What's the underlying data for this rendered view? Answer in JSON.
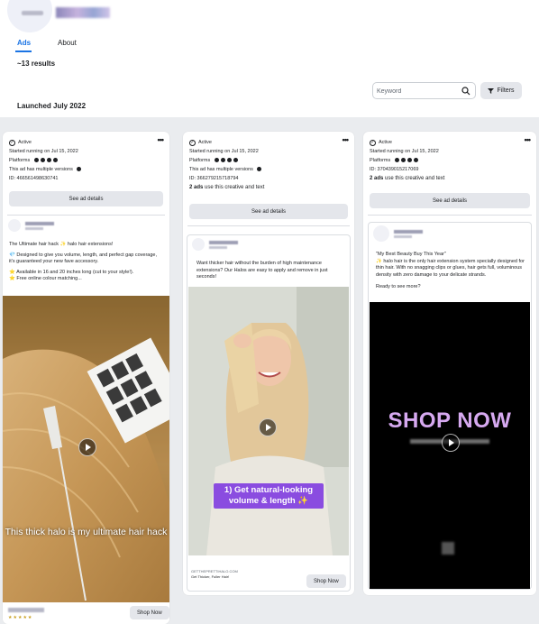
{
  "header": {
    "tabs": [
      {
        "label": "Ads",
        "active": true
      },
      {
        "label": "About",
        "active": false
      }
    ],
    "results": "~13 results",
    "search": {
      "placeholder": "Keyword",
      "value": ""
    },
    "filters_label": "Filters",
    "section_title": "Launched July 2022"
  },
  "cards": [
    {
      "status": "Active",
      "started": "Started running on Jul 15, 2022",
      "platforms_label": "Platforms",
      "versions_note": "This ad has multiple versions",
      "id": "ID: 466561498630741",
      "see_details": "See ad details",
      "creative": {
        "body_lines": [
          "The Ultimate hair hack ✨ halo hair extensions!",
          "💎 Designed to give you volume, length, and perfect gap coverage, it’s guaranteed your new fave accessory.",
          "⭐ Available in 16 and 20 inches long (cut to your style!).",
          "⭐ Free online colour matching..."
        ],
        "video_caption": "This thick halo is my ultimate hair hack",
        "cta": "Shop Now"
      }
    },
    {
      "status": "Active",
      "started": "Started running on Jul 15, 2022",
      "platforms_label": "Platforms",
      "versions_note": "This ad has multiple versions",
      "id": "ID: 366279215718794",
      "ads_count": "2 ads",
      "ads_count_rest": "use this creative and text",
      "see_details": "See ad details",
      "creative": {
        "body_lines": [
          "Want thicker hair without the burden of high maintenance extensions? Our Halos are easy to apply and remove in just seconds!"
        ],
        "video_caption": "1) Get natural-looking volume & length ✨",
        "link_domain": "GETTHEPRETTIHALO.COM",
        "link_title": "Get Thicker, Fuller Hair!",
        "cta": "Shop Now"
      }
    },
    {
      "status": "Active",
      "started": "Started running on Jul 15, 2022",
      "platforms_label": "Platforms",
      "id": "ID: 370439015217069",
      "ads_count": "2 ads",
      "ads_count_rest": "use this creative and text",
      "see_details": "See ad details",
      "creative": {
        "body_lines": [
          "\"My Best Beauty Buy This Year\"",
          "✨ halo hair is the only hair extension system specially designed for thin hair. With no snagging clips or glues, hair gets full, voluminous density with zero damage to your delicate strands.",
          "Ready to see more?"
        ],
        "video_text": "SHOP NOW"
      }
    }
  ],
  "colors": {
    "accent": "#1b74e4",
    "feed_bg": "#eaecef",
    "shop_now_text": "#d6a9f0",
    "caption_purple": "#8a4ce0"
  }
}
